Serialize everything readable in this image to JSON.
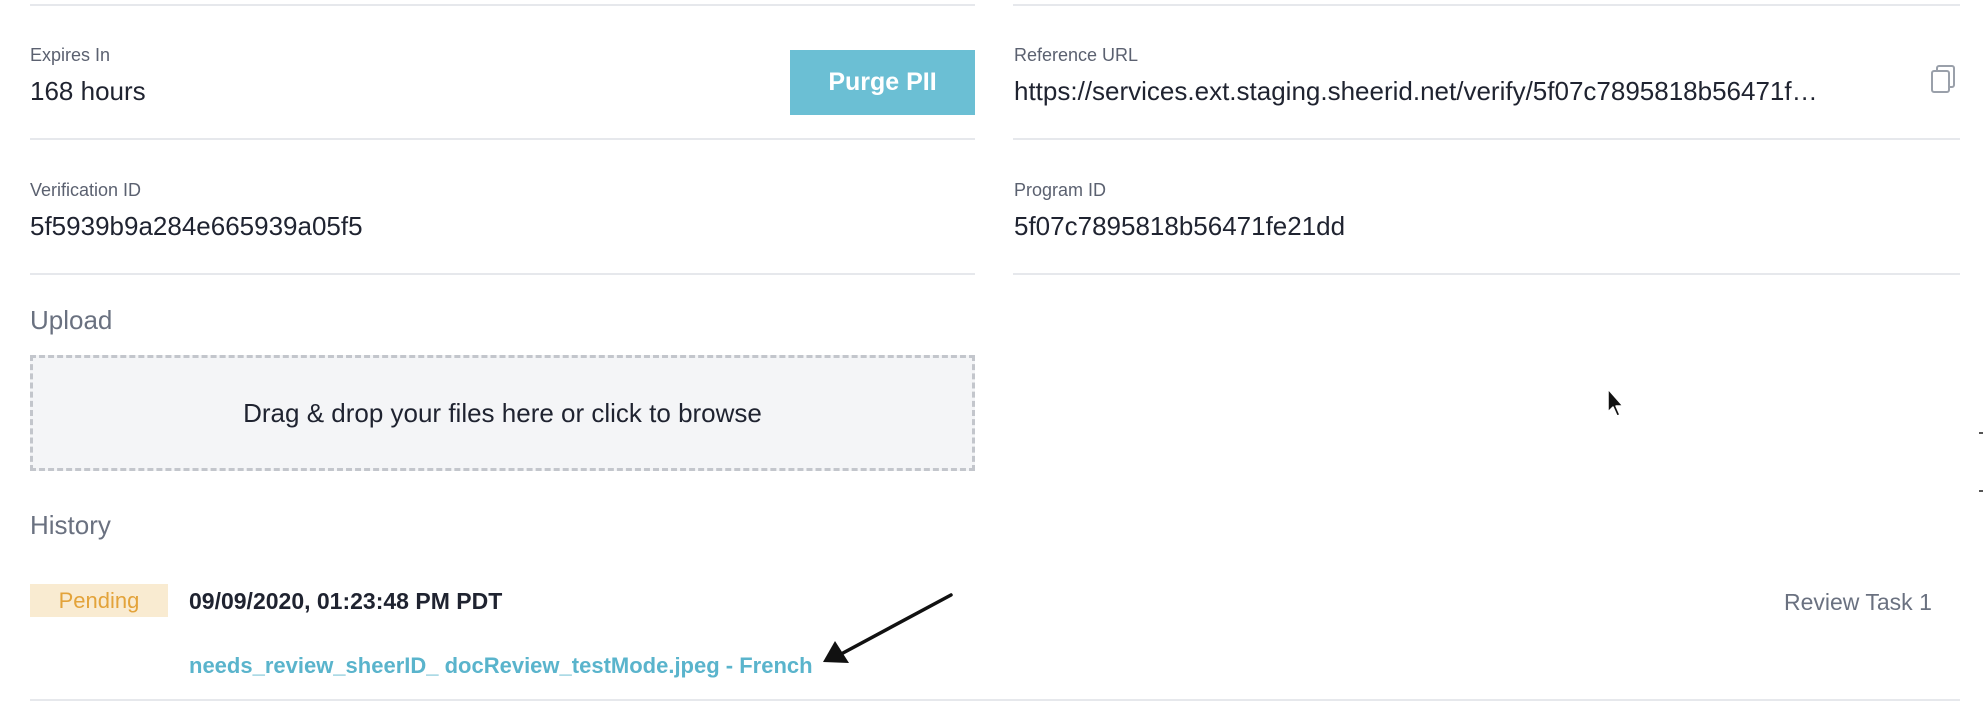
{
  "fields": {
    "expires": {
      "label": "Expires In",
      "value": "168 hours"
    },
    "purge_button": "Purge PII",
    "reference_url": {
      "label": "Reference URL",
      "value": "https://services.ext.staging.sheerid.net/verify/5f07c7895818b56471f…",
      "copy_icon": "copy-icon"
    },
    "verification_id": {
      "label": "Verification ID",
      "value": "5f5939b9a284e665939a05f5"
    },
    "program_id": {
      "label": "Program ID",
      "value": "5f07c7895818b56471fe21dd"
    }
  },
  "upload": {
    "title": "Upload",
    "dropzone_text": "Drag & drop your files here or click to browse"
  },
  "history": {
    "title": "History",
    "entries": [
      {
        "status": "Pending",
        "timestamp": "09/09/2020, 01:23:48 PM PDT",
        "file": "needs_review_sheerID_ docReview_testMode.jpeg - French",
        "task": "Review Task 1"
      }
    ]
  },
  "colors": {
    "accent": "#6bbfd4",
    "link": "#5ab4cc",
    "pending_bg": "#f9ebd1",
    "pending_text": "#e3a33a"
  },
  "annotations": {
    "arrow_icon": "arrow-icon",
    "cursor_icon": "mouse-pointer-icon"
  }
}
